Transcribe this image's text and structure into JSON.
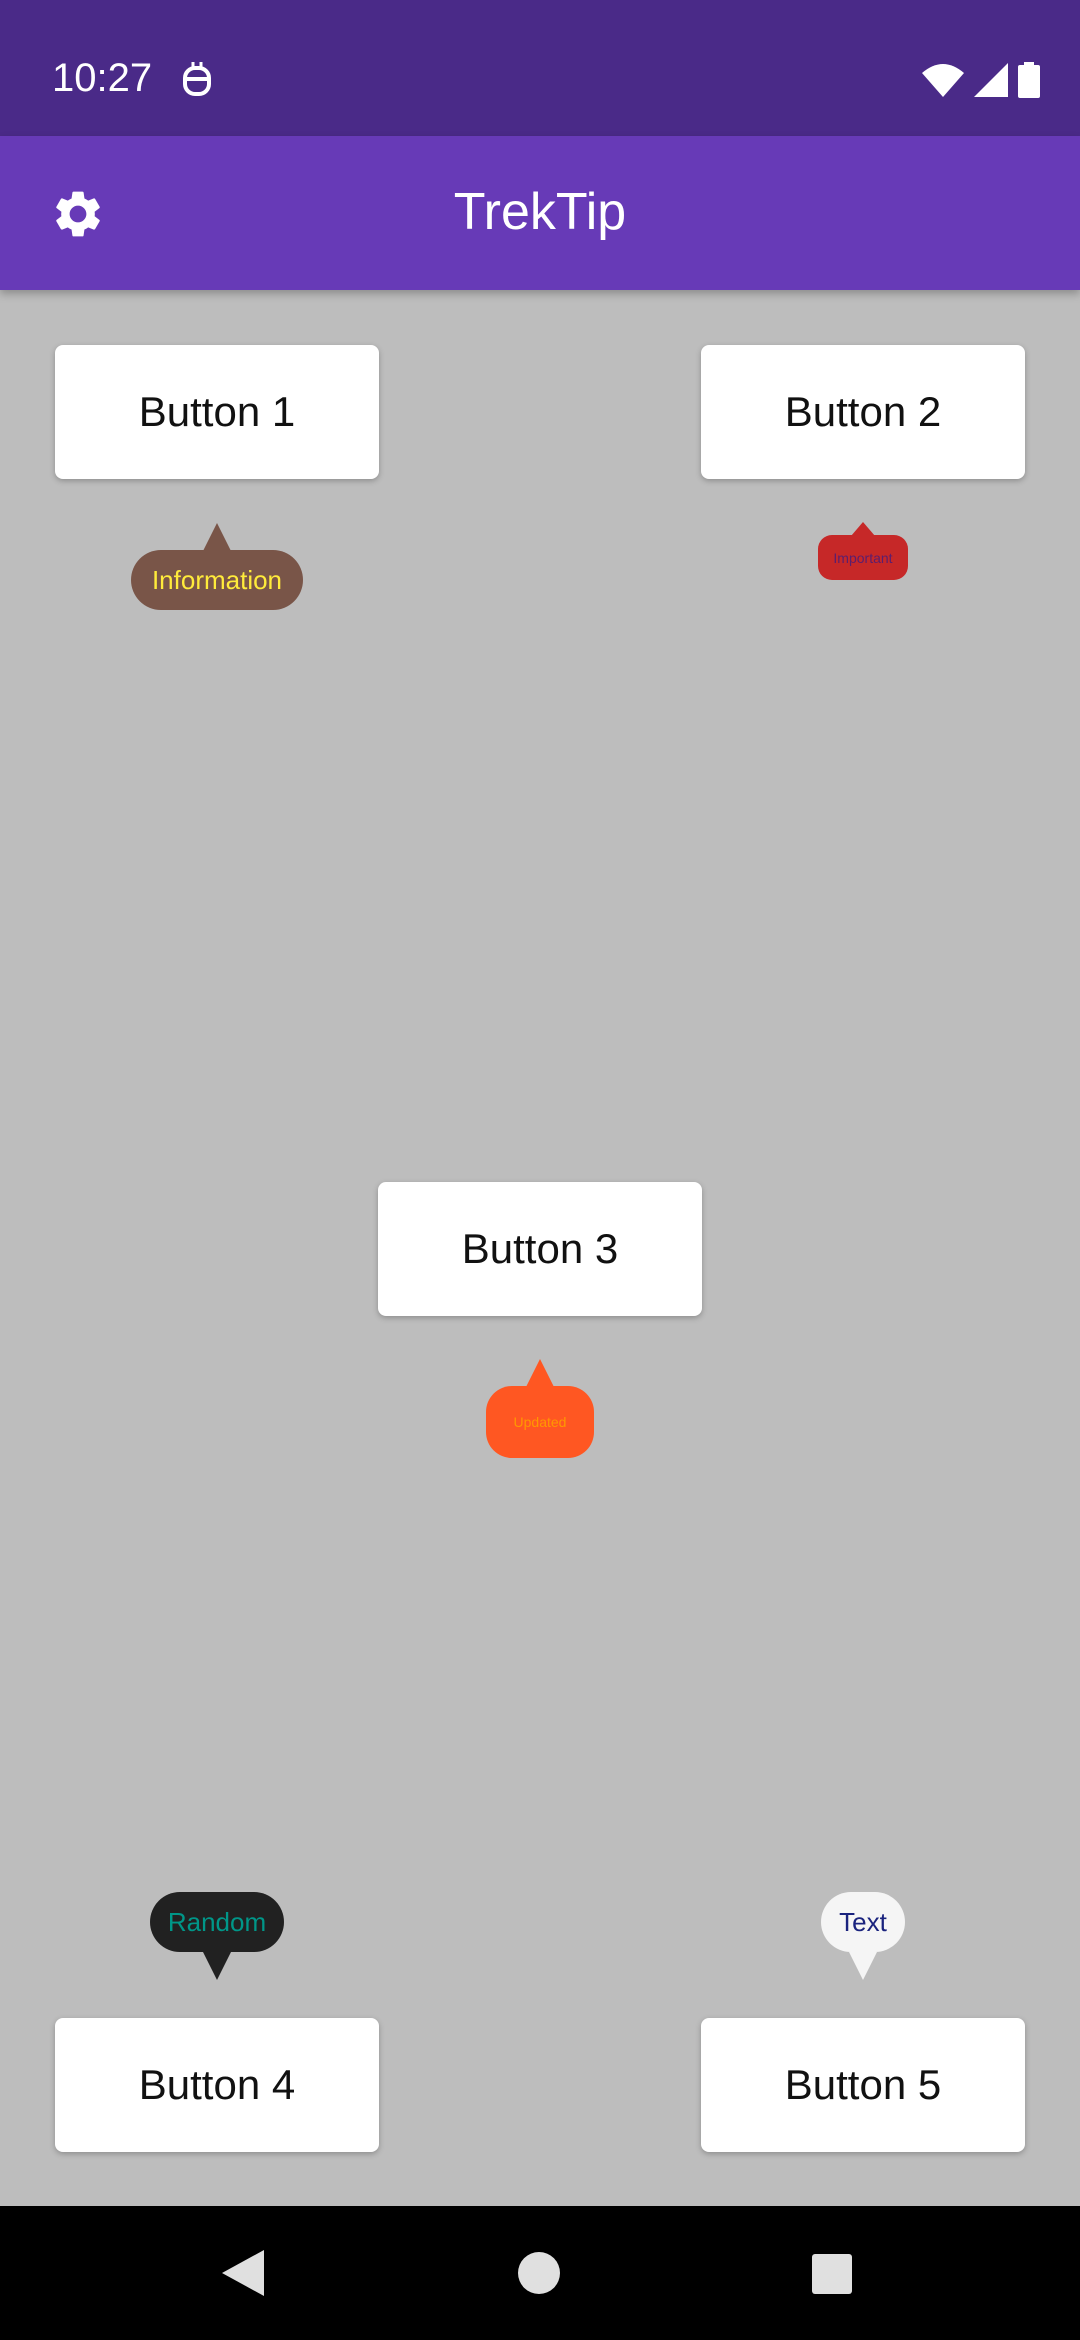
{
  "status_bar": {
    "time": "10:27",
    "icons": [
      "robot-icon",
      "wifi-icon",
      "signal-icon",
      "battery-icon"
    ]
  },
  "app_bar": {
    "title": "TrekTip",
    "background": "#673ab7",
    "icon": "gear-icon"
  },
  "buttons": [
    {
      "label": "Button 1"
    },
    {
      "label": "Button 2"
    },
    {
      "label": "Button 3"
    },
    {
      "label": "Button 4"
    },
    {
      "label": "Button 5"
    }
  ],
  "tooltips": [
    {
      "text": "Information",
      "background": "#795548",
      "text_color": "#ffeb3b",
      "arrow": "up"
    },
    {
      "text": "Important",
      "background": "#c62828",
      "text_color": "#5b1e6e",
      "arrow": "up"
    },
    {
      "text": "Updated",
      "background": "#ff5722",
      "text_color": "#ff9800",
      "arrow": "up"
    },
    {
      "text": "Random",
      "background": "#212121",
      "text_color": "#009688",
      "arrow": "down"
    },
    {
      "text": "Text",
      "background": "#f5f5f5",
      "text_color": "#1a237e",
      "arrow": "down"
    }
  ],
  "nav_bar": {
    "icons": [
      "back-icon",
      "home-icon",
      "recents-icon"
    ]
  }
}
